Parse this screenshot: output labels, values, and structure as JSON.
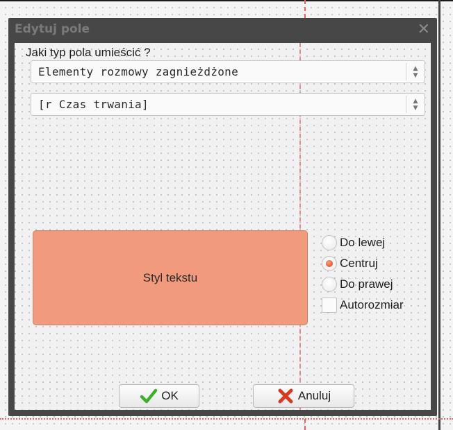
{
  "dialog": {
    "title": "Edytuj pole",
    "question": "Jaki typ pola umieścić ?",
    "type_combo_value": "Elementy rozmowy zagnieżdżone",
    "field_combo_value": "[r Czas trwania]",
    "style_button_label": "Styl tekstu",
    "alignment": {
      "options": [
        "Do lewej",
        "Centruj",
        "Do prawej"
      ],
      "selected": "Centruj"
    },
    "autosize_label": "Autorozmiar",
    "autosize_checked": false,
    "ok_label": "OK",
    "cancel_label": "Anuluj"
  },
  "colors": {
    "style_button_bg": "#f29a7d",
    "window_frame": "#474747",
    "radio_selected": "#e7643e",
    "ok_icon": "#3fae2a",
    "cancel_icon": "#d63a23"
  },
  "icons": {
    "close": "close-icon",
    "ok": "checkmark-icon",
    "cancel": "x-icon",
    "combo_spin": "spin-arrows-icon"
  }
}
